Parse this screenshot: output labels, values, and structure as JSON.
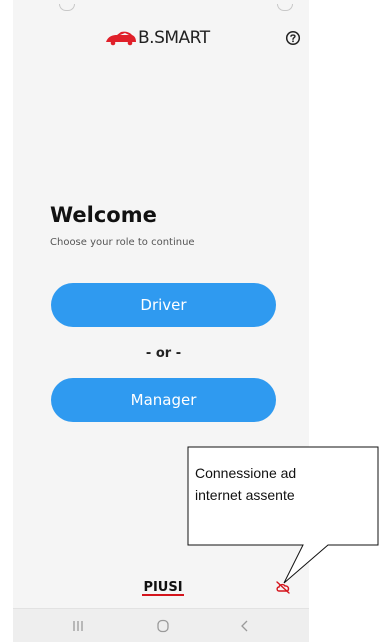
{
  "header": {
    "logo_text": "B.SMART",
    "help_icon": "help-circle-icon"
  },
  "welcome": {
    "title": "Welcome",
    "subtitle": "Choose your role to continue"
  },
  "roles": {
    "driver_label": "Driver",
    "separator": "- or -",
    "manager_label": "Manager"
  },
  "footer": {
    "brand": "PIUSI",
    "status_icon": "cloud-off-icon"
  },
  "annotation": {
    "line1": "Connessione ad",
    "line2": "internet assente"
  },
  "nav": {
    "icons": [
      "recent-apps-icon",
      "home-icon",
      "back-icon"
    ]
  },
  "colors": {
    "accent": "#2f9af0",
    "logo_red": "#e0202a",
    "brand_red": "#d4141c",
    "background": "#f5f5f5"
  }
}
